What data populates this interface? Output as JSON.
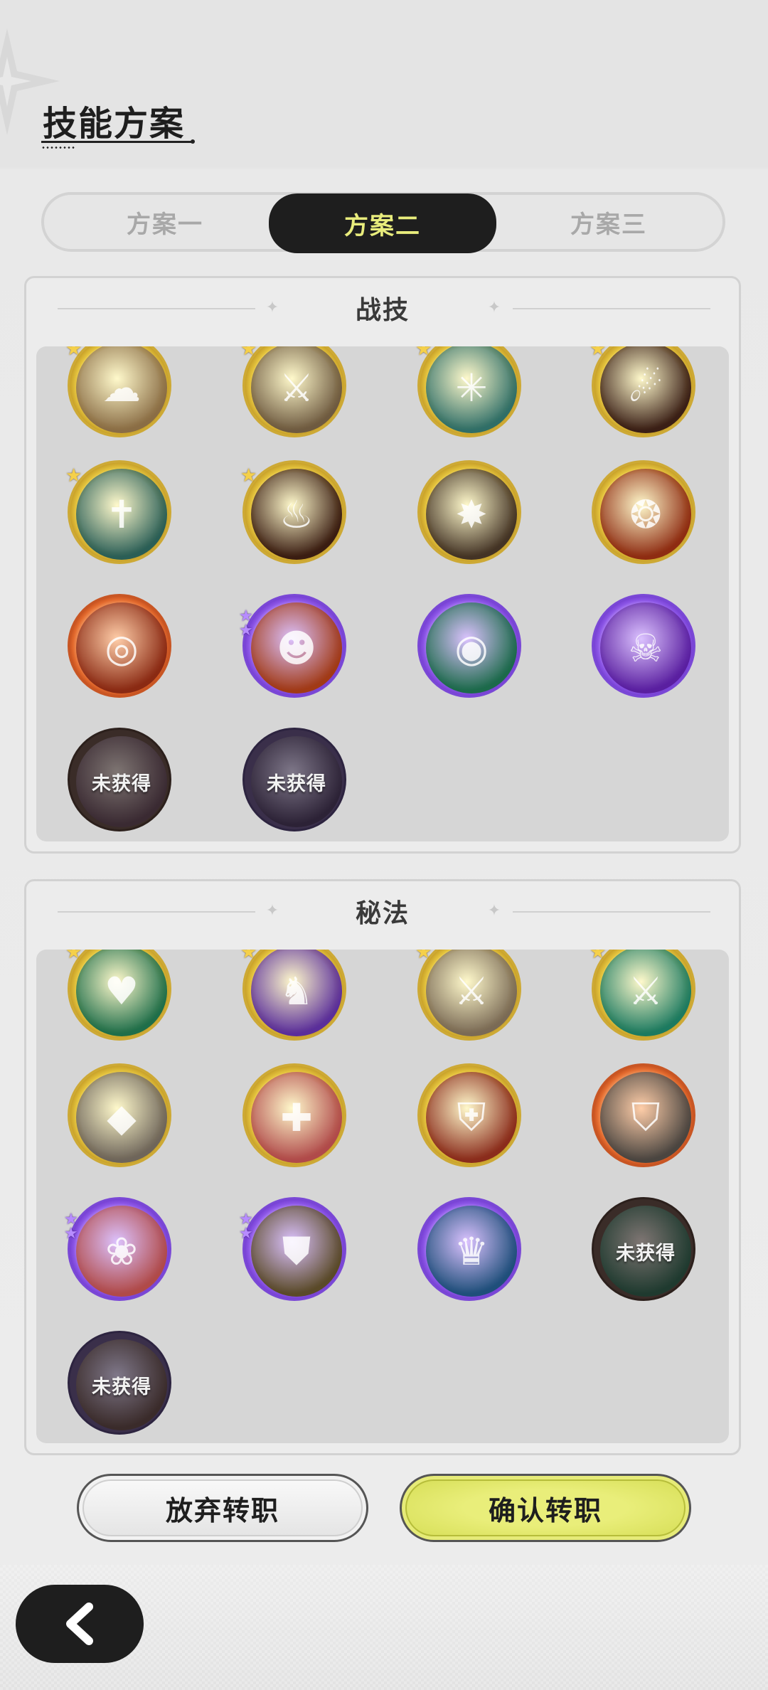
{
  "page_title": "技能方案",
  "tabs": [
    {
      "label": "方案一",
      "active": false
    },
    {
      "label": "方案二",
      "active": true
    },
    {
      "label": "方案三",
      "active": false
    }
  ],
  "battle_skills": {
    "title": "战技",
    "items": [
      {
        "name": "skill-slot",
        "rarity": "gold",
        "starred": true,
        "icon": "beast-claw-icon",
        "color": "#8a6d45"
      },
      {
        "name": "skill-slot",
        "rarity": "gold",
        "starred": true,
        "icon": "sword-slash-icon",
        "color": "#6e5a40"
      },
      {
        "name": "skill-slot",
        "rarity": "gold",
        "starred": true,
        "icon": "spider-web-icon",
        "color": "#2f6e67"
      },
      {
        "name": "skill-slot",
        "rarity": "gold",
        "starred": true,
        "icon": "fire-slash-icon",
        "color": "#3a1f16"
      },
      {
        "name": "skill-slot",
        "rarity": "gold",
        "starred": true,
        "icon": "greatsword-icon",
        "color": "#2a5e56"
      },
      {
        "name": "skill-slot",
        "rarity": "gold",
        "starred": true,
        "icon": "flame-icon",
        "color": "#3a1d12"
      },
      {
        "name": "skill-slot",
        "rarity": "gold",
        "starred": false,
        "icon": "explosion-icon",
        "color": "#433325"
      },
      {
        "name": "skill-slot",
        "rarity": "gold",
        "starred": false,
        "icon": "fire-sigil-icon",
        "color": "#8e2c12"
      },
      {
        "name": "skill-slot",
        "rarity": "orange",
        "starred": false,
        "icon": "fire-swirl-icon",
        "color": "#8a2a13"
      },
      {
        "name": "skill-slot",
        "rarity": "purple",
        "starred": true,
        "icon": "fire-spirit-icon",
        "color": "#a13a16"
      },
      {
        "name": "skill-slot",
        "rarity": "purple",
        "starred": false,
        "icon": "wind-vortex-icon",
        "color": "#1c6a4a"
      },
      {
        "name": "skill-slot",
        "rarity": "purple",
        "starred": false,
        "icon": "ghost-icon",
        "color": "#5a1fa0"
      },
      {
        "name": "skill-slot",
        "rarity": "dark",
        "starred": false,
        "icon": "locked-skill-icon",
        "color": "#3a2a32",
        "label": "未获得"
      },
      {
        "name": "skill-slot",
        "rarity": "darkpurple",
        "starred": false,
        "icon": "locked-skill-icon",
        "color": "#2c2236",
        "label": "未获得"
      }
    ]
  },
  "secret_arts": {
    "title": "秘法",
    "items": [
      {
        "name": "art-slot",
        "rarity": "gold",
        "starred": true,
        "icon": "heart-heal-icon",
        "color": "#1f6e4a"
      },
      {
        "name": "art-slot",
        "rarity": "gold",
        "starred": true,
        "icon": "wolf-icon",
        "color": "#5a2e9a"
      },
      {
        "name": "art-slot",
        "rarity": "gold",
        "starred": true,
        "icon": "sword-up-icon",
        "color": "#7a6a55"
      },
      {
        "name": "art-slot",
        "rarity": "gold",
        "starred": true,
        "icon": "green-sword-icon",
        "color": "#1c7a60"
      },
      {
        "name": "art-slot",
        "rarity": "gold",
        "starred": false,
        "icon": "blade-icon",
        "color": "#6e655a"
      },
      {
        "name": "art-slot",
        "rarity": "gold",
        "starred": false,
        "icon": "heal-sword-icon",
        "color": "#b04a4a"
      },
      {
        "name": "art-slot",
        "rarity": "gold",
        "starred": false,
        "icon": "armor-icon",
        "color": "#8a2c1c"
      },
      {
        "name": "art-slot",
        "rarity": "orange",
        "starred": false,
        "icon": "shield-guard-icon",
        "color": "#4a4540"
      },
      {
        "name": "art-slot",
        "rarity": "purple",
        "starred": true,
        "icon": "cloud-burst-icon",
        "color": "#b04a48"
      },
      {
        "name": "art-slot",
        "rarity": "purple",
        "starred": true,
        "icon": "shield-figure-icon",
        "color": "#5a4a28"
      },
      {
        "name": "art-slot",
        "rarity": "purple",
        "starred": false,
        "icon": "crown-gem-icon",
        "color": "#1f4f7a"
      },
      {
        "name": "art-slot",
        "rarity": "dark",
        "starred": false,
        "icon": "locked-skill-icon",
        "color": "#1f3a2f",
        "label": "未获得"
      },
      {
        "name": "art-slot",
        "rarity": "darkpurple",
        "starred": false,
        "icon": "locked-skill-icon",
        "color": "#3a2b2a",
        "label": "未获得"
      }
    ]
  },
  "buttons": {
    "abandon": "放弃转职",
    "confirm": "确认转职",
    "back_icon": "chevron-left-icon"
  },
  "colors": {
    "accent_yellow": "#e8ec7c",
    "dark": "#1e1e1e",
    "gold_rim": "#d4b03a",
    "purple_rim": "#7a48d6",
    "orange_rim": "#c85624"
  }
}
